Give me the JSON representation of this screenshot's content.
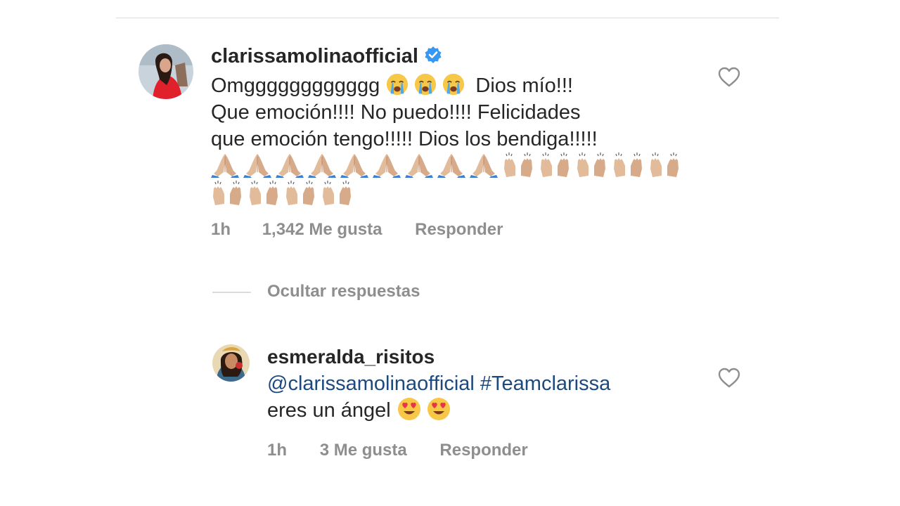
{
  "comment": {
    "username": "clarissamolinaofficial",
    "verified_icon": "verified-badge-icon",
    "text_line1_a": "Omgggggggggggg",
    "text_line1_b": "Dios mío!!!",
    "text_line2": "Que emoción!!!! No puedo!!!! Felicidades",
    "text_line3": "que emoción tengo!!!!! Dios los bendiga!!!!!",
    "emoji_line1": [
      "crying",
      "crying",
      "crying"
    ],
    "praying_count": 9,
    "raising_hands_row1_count": 5,
    "raising_hands_row2_count": 4,
    "time": "1h",
    "likes": "1,342 Me gusta",
    "reply": "Responder"
  },
  "hide_replies": "Ocultar respuestas",
  "reply": {
    "username": "esmeralda_risitos",
    "mention": "@clarissamolinaofficial",
    "hashtag": "#Teamclarissa",
    "text": "eres un ángel",
    "emoji": [
      "heart-eyes",
      "heart-eyes"
    ],
    "time": "1h",
    "likes": "3 Me gusta",
    "reply": "Responder"
  },
  "colors": {
    "text": "#262626",
    "meta": "#8e8e8e",
    "link": "#1c4a7f",
    "verified": "#3897f0",
    "divider": "#dbdbdb"
  }
}
